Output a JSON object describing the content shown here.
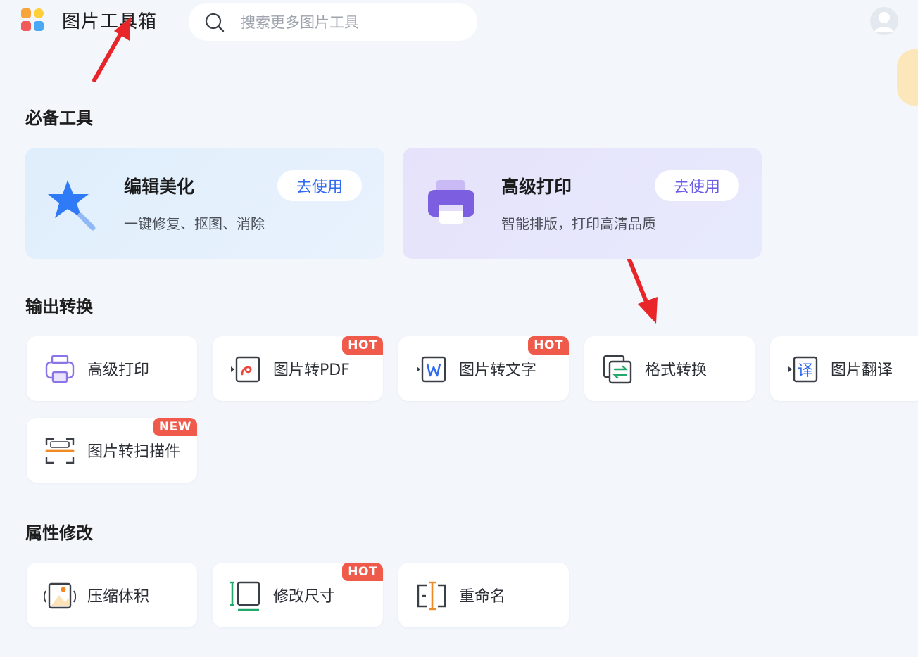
{
  "app": {
    "title": "图片工具箱"
  },
  "search": {
    "placeholder": "搜索更多图片工具"
  },
  "colors": {
    "accent_blue": "#2f6af2",
    "accent_purple": "#6b5ce7",
    "badge_red": "#f05a4b",
    "annotation_red": "#e8262a"
  },
  "sections": {
    "essential": {
      "title": "必备工具",
      "cards": [
        {
          "title": "编辑美化",
          "desc": "一键修复、抠图、消除",
          "button": "去使用",
          "icon": "magic-wand-icon"
        },
        {
          "title": "高级打印",
          "desc": "智能排版，打印高清品质",
          "button": "去使用",
          "icon": "printer-icon"
        }
      ]
    },
    "output": {
      "title": "输出转换",
      "tools": [
        {
          "label": "高级打印",
          "icon": "printer-outline-icon",
          "badge": ""
        },
        {
          "label": "图片转PDF",
          "icon": "pdf-convert-icon",
          "badge": "HOT"
        },
        {
          "label": "图片转文字",
          "icon": "word-convert-icon",
          "badge": "HOT"
        },
        {
          "label": "格式转换",
          "icon": "format-convert-icon",
          "badge": ""
        },
        {
          "label": "图片翻译",
          "icon": "translate-icon",
          "badge": ""
        },
        {
          "label": "图片转扫描件",
          "icon": "scan-icon",
          "badge": "NEW"
        }
      ]
    },
    "attributes": {
      "title": "属性修改",
      "tools": [
        {
          "label": "压缩体积",
          "icon": "compress-icon",
          "badge": ""
        },
        {
          "label": "修改尺寸",
          "icon": "resize-icon",
          "badge": "HOT"
        },
        {
          "label": "重命名",
          "icon": "rename-icon",
          "badge": ""
        }
      ]
    }
  }
}
